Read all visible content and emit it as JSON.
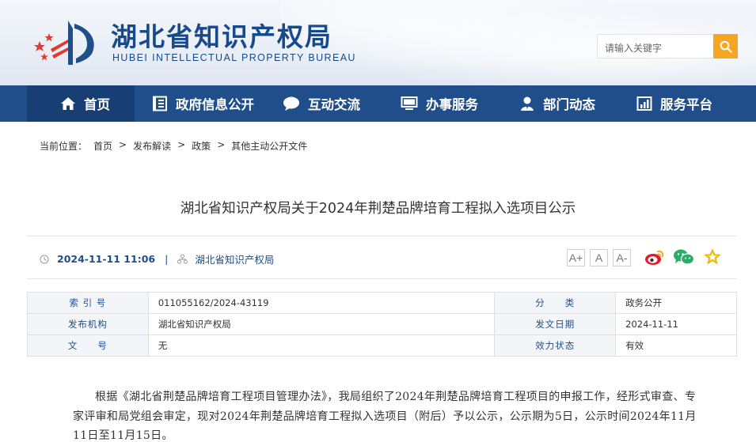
{
  "site": {
    "title": "湖北省知识产权局",
    "subtitle": "HUBEI INTELLECTUAL PROPERTY BUREAU"
  },
  "search": {
    "placeholder": "请输入关键字"
  },
  "nav": {
    "items": [
      {
        "label": "首页",
        "icon": "home-icon"
      },
      {
        "label": "政府信息公开",
        "icon": "document-list-icon"
      },
      {
        "label": "互动交流",
        "icon": "chat-bubble-icon"
      },
      {
        "label": "办事服务",
        "icon": "monitor-icon"
      },
      {
        "label": "部门动态",
        "icon": "person-icon"
      },
      {
        "label": "服务平台",
        "icon": "bar-chart-icon"
      }
    ]
  },
  "breadcrumb": {
    "prefix": "当前位置：",
    "items": [
      "首页",
      "发布解读",
      "政策",
      "其他主动公开文件"
    ],
    "separator": ">"
  },
  "article": {
    "title": "湖北省知识产权局关于2024年荆楚品牌培育工程拟入选项目公示",
    "date": "2024-11-11 11:06",
    "meta_separator": "|",
    "source": "湖北省知识产权局",
    "font_sizes": [
      "A+",
      "A",
      "A-"
    ],
    "share_icons": [
      "weibo-icon",
      "wechat-icon",
      "favorite-star-icon"
    ]
  },
  "info_table": {
    "rows": [
      [
        {
          "k": "索 引 号",
          "v": "011055162/2024-43119"
        },
        {
          "k": "分　　类",
          "v": "政务公开"
        }
      ],
      [
        {
          "k": "发布机构",
          "v": "湖北省知识产权局"
        },
        {
          "k": "发文日期",
          "v": "2024-11-11"
        }
      ],
      [
        {
          "k": "文　　号",
          "v": "无"
        },
        {
          "k": "效力状态",
          "v": "有效"
        }
      ]
    ]
  },
  "body": {
    "paragraph": "根据《湖北省荆楚品牌培育工程项目管理办法》，我局组织了2024年荆楚品牌培育工程项目的申报工作，经形式审查、专家评审和局党组会审定，现对2024年荆楚品牌培育工程拟入选项目（附后）予以公示，公示期为5日，公示时间2024年11月11日至11月15日。"
  },
  "colors": {
    "brand_blue": "#1f4e8a",
    "nav_active": "#173f73",
    "search_orange": "#f5a623",
    "logo_red": "#e23a2e"
  }
}
